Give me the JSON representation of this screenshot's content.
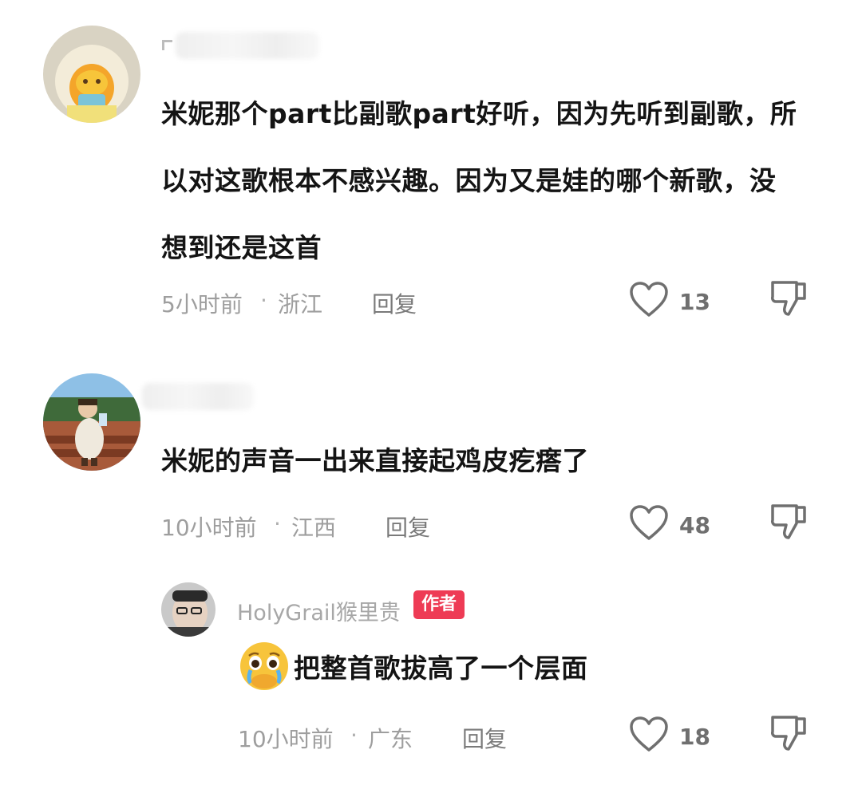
{
  "comments": [
    {
      "content_lines": [
        "米妮那个part比副歌part好听，因为先听到副歌，所",
        "以对这歌根本不感兴趣。因为又是娃的哪个新歌，没",
        "想到还是这首"
      ],
      "time": "5小时前",
      "separator": "·",
      "location": "浙江",
      "reply_label": "回复",
      "likes": "13"
    },
    {
      "content_lines": [
        "米妮的声音一出来直接起鸡皮疙瘩了"
      ],
      "time": "10小时前",
      "separator": "·",
      "location": "江西",
      "reply_label": "回复",
      "likes": "48"
    }
  ],
  "reply": {
    "username": "HolyGrail猴里贵",
    "badge": "作者",
    "content": "把整首歌拔高了一个层面",
    "emoji": "pleading-crying-face",
    "time": "10小时前",
    "separator": "·",
    "location": "广东",
    "reply_label": "回复",
    "likes": "18"
  },
  "colors": {
    "badge": "#ee3b55",
    "text": "#141414",
    "meta": "#9e9e9e",
    "icon": "#6f6f6f"
  }
}
